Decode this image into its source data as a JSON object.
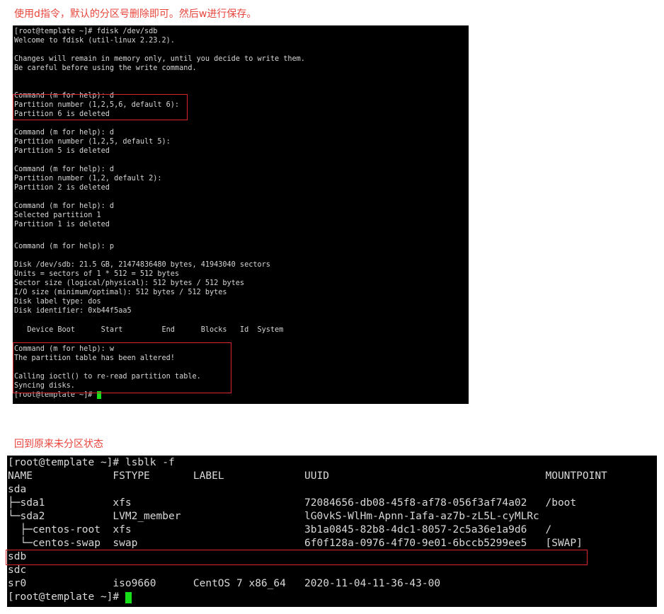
{
  "caption_top": "使用d指令，默认的分区号删除即可。然后w进行保存。",
  "caption_mid": "回到原来未分区状态",
  "colors": {
    "caption": "#e8453c",
    "highlight_border": "#d9262e",
    "cursor": "#18e018",
    "terminal_bg": "#000000"
  },
  "term1": {
    "lines": [
      "[root@template ~]# fdisk /dev/sdb",
      "Welcome to fdisk (util-linux 2.23.2).",
      "",
      "Changes will remain in memory only, until you decide to write them.",
      "Be careful before using the write command.",
      "",
      "",
      "Command (m for help): d",
      "Partition number (1,2,5,6, default 6):",
      "Partition 6 is deleted",
      "",
      "Command (m for help): d",
      "Partition number (1,2,5, default 5):",
      "Partition 5 is deleted",
      "",
      "Command (m for help): d",
      "Partition number (1,2, default 2):",
      "Partition 2 is deleted",
      "",
      "Command (m for help): d",
      "Selected partition 1",
      "Partition 1 is deleted",
      "",
      "Command (m for help): p",
      "",
      "Disk /dev/sdb: 21.5 GB, 21474836480 bytes, 41943040 sectors",
      "Units = sectors of 1 * 512 = 512 bytes",
      "Sector size (logical/physical): 512 bytes / 512 bytes",
      "I/O size (minimum/optimal): 512 bytes / 512 bytes",
      "Disk label type: dos",
      "Disk identifier: 0xb44f5aa5",
      "",
      "   Device Boot      Start         End      Blocks   Id  System",
      "",
      "Command (m for help): w",
      "The partition table has been altered!",
      "",
      "Calling ioctl() to re-read partition table.",
      "Syncing disks."
    ],
    "prompt": "[root@template ~]# "
  },
  "term2": {
    "lines": [
      "[root@template ~]# lsblk -f",
      "NAME             FSTYPE       LABEL             UUID                                   MOUNTPOINT",
      "sda",
      "├─sda1           xfs                            72084656-db08-45f8-af78-056f3af74a02   /boot",
      "└─sda2           LVM2_member                    lG0vkS-WlHm-Apnn-Iafa-az7b-zL5L-cyMLRc",
      "  ├─centos-root  xfs                            3b1a0845-82b8-4dc1-8057-2c5a36e1a9d6   /",
      "  └─centos-swap  swap                           6f0f128a-0976-4f70-9e01-6bccb5299ee5   [SWAP]",
      "sdb",
      "sdc",
      "sr0              iso9660      CentOS 7 x86_64   2020-11-04-11-36-43-00"
    ],
    "prompt": "[root@template ~]# "
  }
}
